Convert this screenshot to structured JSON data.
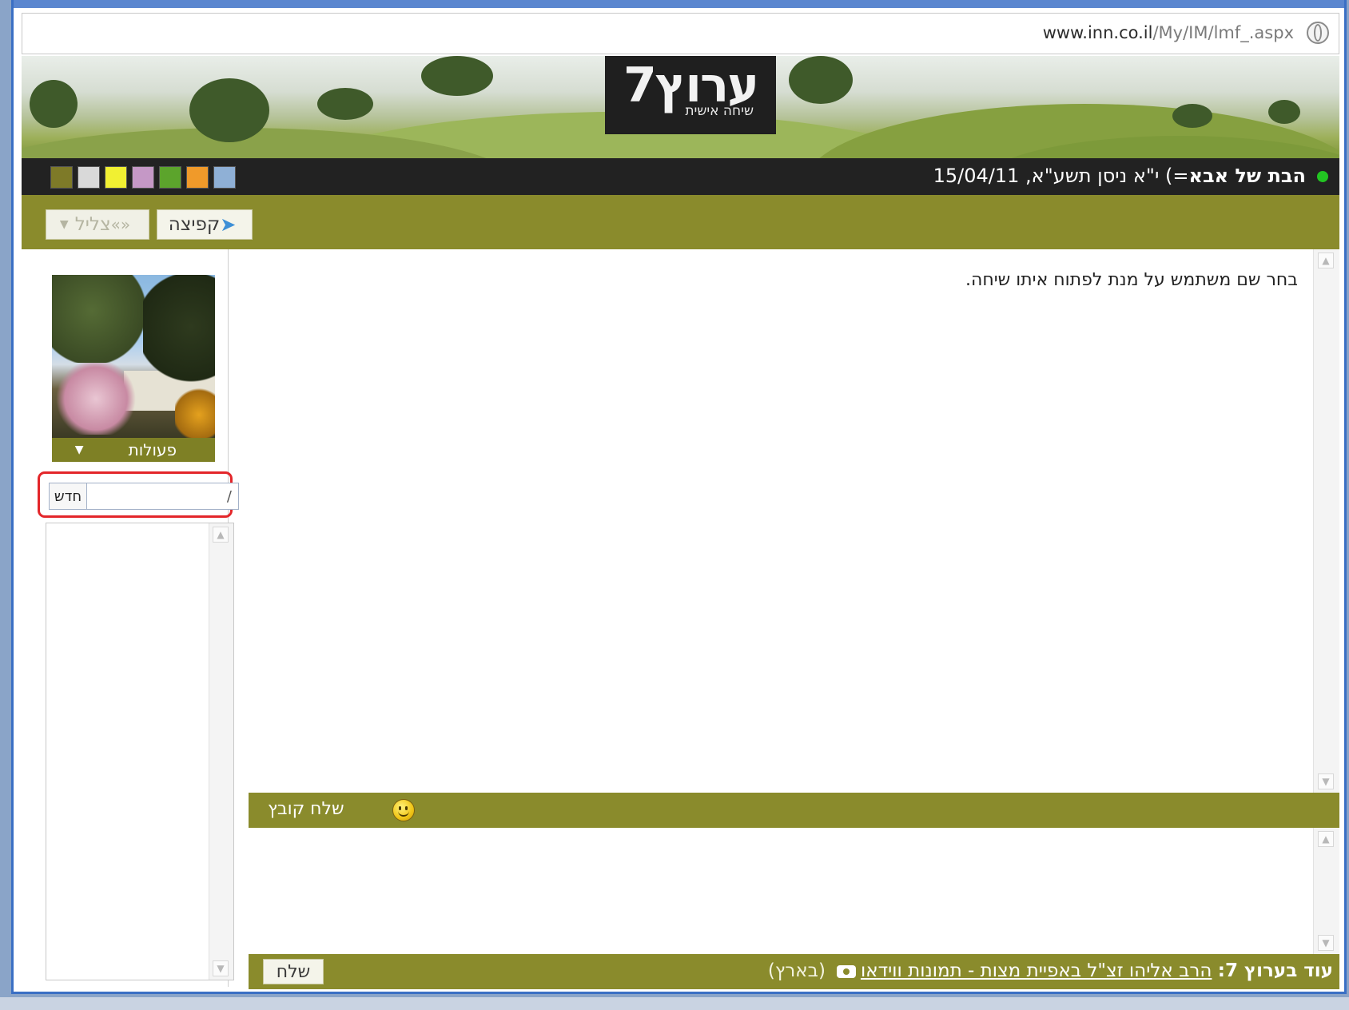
{
  "browser": {
    "url_host": "www.inn.co.il",
    "url_path": "/My/IM/lmf_.aspx"
  },
  "logo": {
    "main": "ערוץ7",
    "sub": "שיחה אישית"
  },
  "status": {
    "username": "הבת של אבא",
    "suffix": "=)",
    "date_hebrew": "י\"א ניסן תשע\"א,",
    "date": "15/04/11"
  },
  "colors": {
    "swatches": [
      "#7e7a28",
      "#d9d9d9",
      "#f1f032",
      "#c598c6",
      "#5ca42c",
      "#f09a2a",
      "#8fb0d6"
    ],
    "accent_olive": "#8a8b2c",
    "status_online": "#22c522"
  },
  "toolbar": {
    "jump_label": "קפיצה",
    "jump_icon": "jump-arrow-icon",
    "ring_label": "צליל",
    "ring_icon": "sound-icon"
  },
  "sidebar": {
    "actions_label": "פעולות",
    "actions_icon": "caret-down-icon",
    "new_button_label": "חדש",
    "search_value": "/"
  },
  "chat": {
    "placeholder_message": "בחר שם משתמש על מנת לפתוח איתו שיחה."
  },
  "compose": {
    "emoticon_icon": "smiley-icon",
    "send_file_label": "שלח קובץ",
    "send_label": "שלח"
  },
  "footer": {
    "more_label": "עוד בערוץ 7:",
    "headline": "הרב אליהו זצ\"ל באפיית מצות - תמונות ווידאו",
    "video_icon": "camera-icon",
    "region": "(בארץ)"
  }
}
